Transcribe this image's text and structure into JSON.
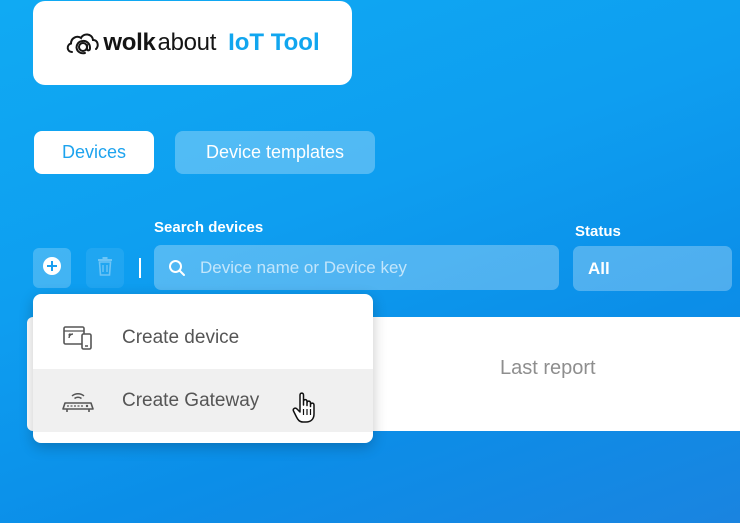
{
  "logo": {
    "brand_bold": "wolk",
    "brand_regular": "about",
    "product": "IoT Tool",
    "icon": "cloud-at-icon",
    "accent_color": "#11a6ef"
  },
  "tabs": [
    {
      "label": "Devices",
      "active": true
    },
    {
      "label": "Device templates",
      "active": false
    }
  ],
  "toolbar": {
    "add_icon": "plus-circle-icon",
    "delete_icon": "trash-icon"
  },
  "search": {
    "label": "Search devices",
    "placeholder": "Device name or Device key",
    "value": "",
    "icon": "search-icon"
  },
  "status": {
    "label": "Status",
    "value": "All"
  },
  "table": {
    "columns": [
      "Last report"
    ]
  },
  "create_menu": {
    "items": [
      {
        "label": "Create device",
        "icon": "device-icon"
      },
      {
        "label": "Create Gateway",
        "icon": "gateway-router-icon"
      }
    ]
  },
  "colors": {
    "background": "#0e9ef0",
    "tab_active_text": "#1da3ee",
    "menu_hover": "#f0f0f0"
  }
}
